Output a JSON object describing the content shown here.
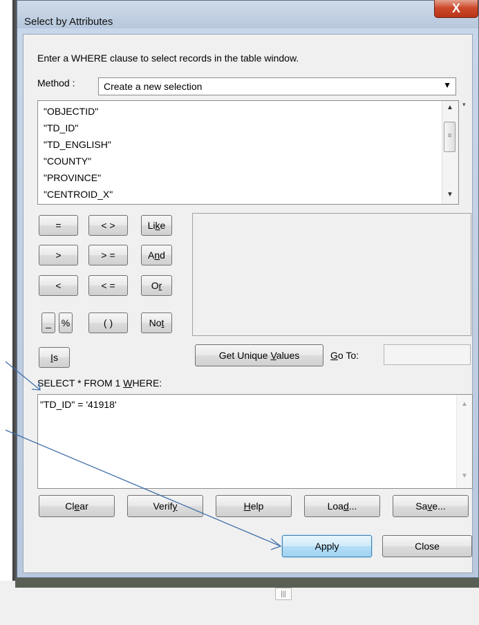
{
  "dialog": {
    "title": "Select by Attributes",
    "close_glyph": "X",
    "instruction": "Enter a WHERE clause to select records in the table window.",
    "method_label": "Method :",
    "method_value": "Create a new selection",
    "fields": [
      "\"OBJECTID\"",
      "\"TD_ID\"",
      "\"TD_ENGLISH\"",
      "\"COUNTY\"",
      "\"PROVINCE\"",
      "\"CENTROID_X\""
    ],
    "operators": {
      "eq": "=",
      "neq": "< >",
      "gt": ">",
      "gte": "> =",
      "lt": "<",
      "lte": "< =",
      "underscore": "_",
      "percent": "%",
      "parens": "( )"
    },
    "like_btn": {
      "pre": "Li",
      "key": "k",
      "post": "e"
    },
    "and_btn": {
      "pre": "A",
      "key": "n",
      "post": "d"
    },
    "or_btn": {
      "pre": "O",
      "key": "r",
      "post": ""
    },
    "not_btn": {
      "pre": "No",
      "key": "t",
      "post": ""
    },
    "is_btn": {
      "pre": "",
      "key": "I",
      "post": "s"
    },
    "unique_btn": {
      "pre": "Get Unique ",
      "key": "V",
      "post": "alues"
    },
    "goto": {
      "pre": "",
      "key": "G",
      "post": "o To:"
    },
    "select_stmt": {
      "pre": "SELECT * FROM 1 ",
      "key": "W",
      "post": "HERE:"
    },
    "expression": "\"TD_ID\" = '41918'",
    "clear_btn": {
      "pre": "Cl",
      "key": "e",
      "post": "ar"
    },
    "verify_btn": {
      "pre": "Verif",
      "key": "y",
      "post": ""
    },
    "help_btn": {
      "pre": "",
      "key": "H",
      "post": "elp"
    },
    "load_btn": {
      "pre": "Loa",
      "key": "d",
      "post": "..."
    },
    "save_btn": {
      "pre": "Sa",
      "key": "v",
      "post": "e..."
    },
    "apply_label": "Apply",
    "close_label": "Close"
  },
  "grip_glyph": "|||",
  "scroll_glyphs": {
    "up": "▲",
    "down": "▼",
    "thumb": "≡"
  },
  "colors": {
    "apply_border": "#3c7fb1",
    "arrow": "#3f6fa8",
    "close_red": "#c8452b"
  }
}
